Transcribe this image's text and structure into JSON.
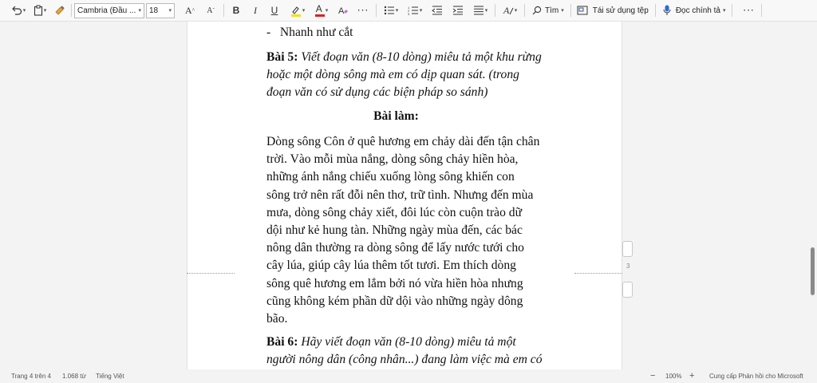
{
  "toolbar": {
    "font_name": "Cambria (Đầu ...",
    "font_size": "18",
    "find_label": "Tìm",
    "reuse_label": "Tái sử dụng tệp",
    "read_label": "Đọc chính tả",
    "icons": [
      "undo-icon",
      "paste-icon",
      "format-painter-icon",
      "grow-font-icon",
      "shrink-font-icon",
      "bold-icon",
      "italic-icon",
      "underline-icon",
      "highlight-icon",
      "font-color-icon",
      "clear-format-icon",
      "more-icon",
      "bullets-icon",
      "numbering-icon",
      "decrease-indent-icon",
      "increase-indent-icon",
      "align-icon",
      "styles-icon",
      "search-icon",
      "reuse-files-icon",
      "microphone-icon",
      "more-icon"
    ],
    "grow_font": "A",
    "shrink_font": "A",
    "bold": "B",
    "italic": "I",
    "underline": "U",
    "font_color_letter": "A",
    "highlight_color": "#f5e020",
    "font_color": "#e0201b"
  },
  "document": {
    "bullet_dash": "-",
    "bullet_text": "Nhanh như cắt",
    "q5_label": "Bài 5:",
    "q5_lines": [
      "Viết đoạn văn (8-10 dòng) miêu tả một khu rừng",
      "hoặc một dòng sông mà em có dịp quan sát. (trong",
      "đoạn văn có sử dụng các biện pháp so sánh)"
    ],
    "bai_lam": "Bài làm:",
    "paragraph_lines": [
      "Dòng sông Côn ở quê hương em chảy dài đến tận chân",
      "trời. Vào mỗi mùa nắng, dòng sông chảy hiền hòa,",
      "những ánh nắng chiếu xuống lòng sông khiến con",
      "sông trở nên rất đỗi nên thơ, trữ tình. Nhưng đến mùa",
      "mưa, dòng sông chảy xiết, đôi lúc còn cuộn trào dữ",
      "dội như kẻ hung tàn. Những ngày mùa đến, các bác",
      "nông dân thường ra dòng sông để lấy nước tưới cho",
      "cây lúa, giúp cây lúa thêm tốt tươi. Em thích dòng",
      "sông quê hương em lắm bởi nó vừa hiền hòa nhưng",
      "cũng không kém phần dữ dội vào những ngày dông",
      "bão."
    ],
    "q6_label": "Bài 6:",
    "q6_lines": [
      "Hãy viết đoạn văn (8-10 dòng) miêu tả một",
      "người nông dân (công nhân...) đang làm việc mà em có"
    ],
    "page_number": "3"
  },
  "statusbar": {
    "page": "Trang 4 trên 4",
    "words": "1.068 từ",
    "language": "Tiếng Việt",
    "zoom_out": "−",
    "zoom": "100%",
    "zoom_in": "+",
    "feedback": "Cung cấp Phản hồi cho Microsoft"
  }
}
